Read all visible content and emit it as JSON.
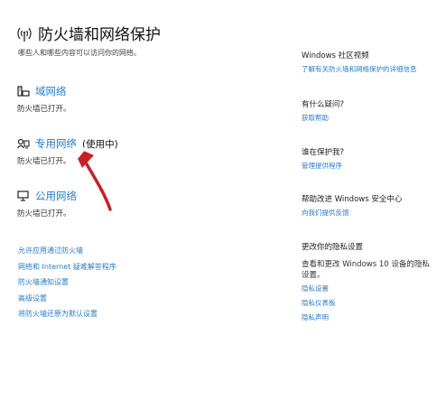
{
  "header": {
    "title": "防火墙和网络保护",
    "subtitle": "哪些人和哪些内容可以访问你的网络。",
    "icon": "wifi-signal-icon"
  },
  "networks": [
    {
      "label": "域网络",
      "state": "",
      "desc": "防火墙已打开。",
      "icon": "domain-network-icon"
    },
    {
      "label": "专用网络",
      "state": "(使用中)",
      "desc": "防火墙已打开。",
      "icon": "private-network-icon"
    },
    {
      "label": "公用网络",
      "state": "",
      "desc": "防火墙已打开。",
      "icon": "public-network-icon"
    }
  ],
  "links": [
    "允许应用通过防火墙",
    "网络和 Internet 疑难解答程序",
    "防火墙通知设置",
    "高级设置",
    "将防火墙还原为默认设置"
  ],
  "sidebar": {
    "video": {
      "heading": "Windows 社区视频",
      "link": "了解有关防火墙和网络保护的详细信息"
    },
    "question": {
      "heading": "有什么疑问?",
      "link": "获取帮助"
    },
    "protect": {
      "heading": "谁在保护我?",
      "link": "管理提供程序"
    },
    "improve": {
      "heading": "帮助改进 Windows 安全中心",
      "link": "向我们提供反馈"
    },
    "privacy": {
      "heading": "更改你的隐私设置",
      "desc": "查看和更改 Windows 10 设备的隐私设置。",
      "links": [
        "隐私设置",
        "隐私仪表板",
        "隐私声明"
      ]
    }
  },
  "colors": {
    "accent": "#2a7bc4",
    "arrow": "#c8202a"
  }
}
